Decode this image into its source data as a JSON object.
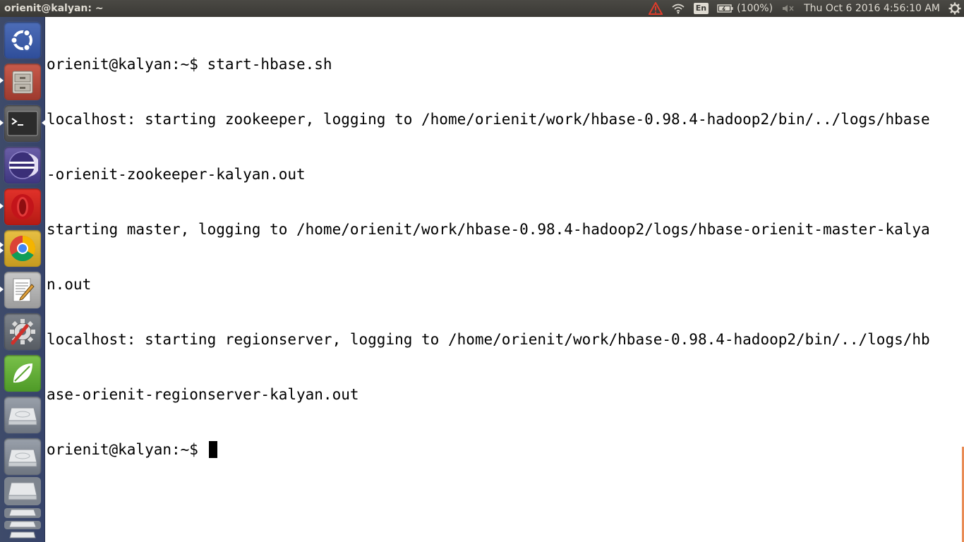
{
  "panel": {
    "window_title": "orienit@kalyan: ~",
    "language": "En",
    "battery": "(100%)",
    "clock": "Thu Oct  6 2016  4:56:10 AM"
  },
  "launcher": {
    "items": [
      {
        "name": "Dash home",
        "icon": "ubuntu-logo-icon"
      },
      {
        "name": "Files",
        "icon": "file-cabinet-icon"
      },
      {
        "name": "Terminal",
        "icon": "terminal-icon"
      },
      {
        "name": "Eclipse",
        "icon": "eclipse-icon"
      },
      {
        "name": "Opera",
        "icon": "opera-icon"
      },
      {
        "name": "Chrome",
        "icon": "chrome-icon"
      },
      {
        "name": "Text Editor",
        "icon": "text-editor-icon"
      },
      {
        "name": "System Settings",
        "icon": "settings-gear-icon"
      },
      {
        "name": "Spring Tool Suite",
        "icon": "spring-leaf-icon"
      },
      {
        "name": "Drive 1",
        "icon": "drive-icon"
      },
      {
        "name": "Drive 2",
        "icon": "drive-icon"
      },
      {
        "name": "Drive stack",
        "icon": "drive-stack-icon"
      }
    ]
  },
  "terminal": {
    "lines": [
      "orienit@kalyan:~$ start-hbase.sh",
      "localhost: starting zookeeper, logging to /home/orienit/work/hbase-0.98.4-hadoop2/bin/../logs/hbase",
      "-orienit-zookeeper-kalyan.out",
      "starting master, logging to /home/orienit/work/hbase-0.98.4-hadoop2/logs/hbase-orienit-master-kalya",
      "n.out",
      "localhost: starting regionserver, logging to /home/orienit/work/hbase-0.98.4-hadoop2/bin/../logs/hb",
      "ase-orienit-regionserver-kalyan.out"
    ],
    "prompt": "orienit@kalyan:~$ "
  },
  "colors": {
    "panel_bg": "#3c3b37",
    "launcher_bg": "#3a4767",
    "terminal_bg": "#ffffff",
    "terminal_fg": "#000000",
    "warning": "#e03c2b"
  }
}
